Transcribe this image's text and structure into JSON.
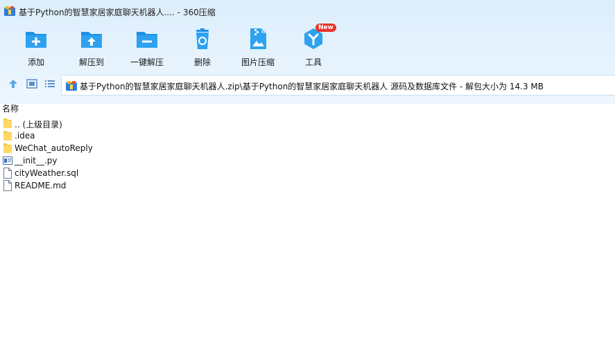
{
  "window": {
    "title": "基于Python的智慧家居家庭聊天机器人.... - 360压缩"
  },
  "toolbar": {
    "items": [
      {
        "label": "添加",
        "icon": "add-icon"
      },
      {
        "label": "解压到",
        "icon": "extract-to-icon"
      },
      {
        "label": "一键解压",
        "icon": "one-click-extract-icon"
      },
      {
        "label": "删除",
        "icon": "delete-icon"
      },
      {
        "label": "图片压缩",
        "icon": "image-compress-icon"
      },
      {
        "label": "工具",
        "icon": "tools-icon",
        "badge": "New"
      }
    ]
  },
  "address": {
    "path": "基于Python的智慧家居家庭聊天机器人.zip\\基于Python的智慧家居家庭聊天机器人 源码及数据库文件 - 解包大小为 14.3 MB"
  },
  "list": {
    "column_name": "名称",
    "rows": [
      {
        "name": ".. (上级目录)",
        "icon": "folder-icon"
      },
      {
        "name": ".idea",
        "icon": "folder-icon"
      },
      {
        "name": "WeChat_autoReply",
        "icon": "folder-icon"
      },
      {
        "name": "__init__.py",
        "icon": "python-file-icon"
      },
      {
        "name": "cityWeather.sql",
        "icon": "file-icon"
      },
      {
        "name": "README.md",
        "icon": "file-icon"
      }
    ]
  },
  "colors": {
    "accent": "#1e90e8",
    "header_bg": "#dceefb",
    "folder": "#f5c94a",
    "badge": "#e8332a"
  }
}
